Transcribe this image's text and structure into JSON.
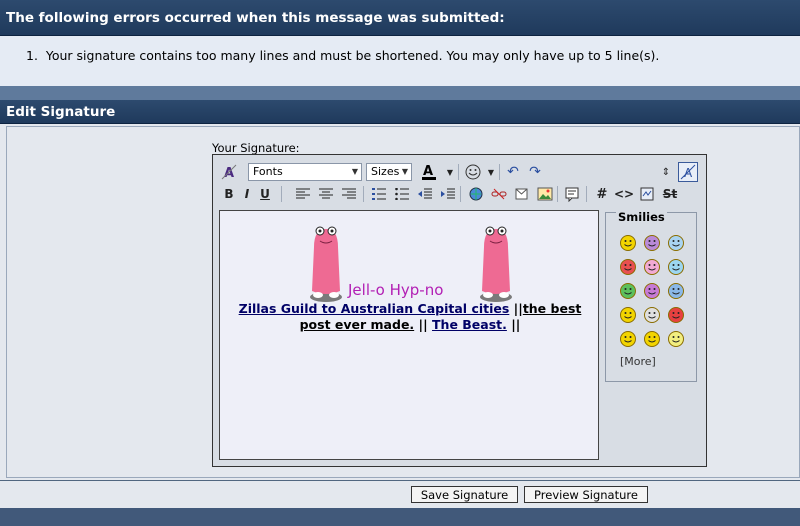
{
  "errors": {
    "title": "The following errors occurred when this message was submitted:",
    "items": [
      "Your signature contains too many lines and must be shortened. You may only have up to 5 line(s)."
    ],
    "numbers": [
      "1."
    ]
  },
  "section": {
    "title": "Edit Signature"
  },
  "editor": {
    "label": "Your Signature:",
    "fonts_value": "Fonts",
    "sizes_value": "Sizes",
    "font_color_glyph": "A",
    "bold": "B",
    "italic": "I",
    "underline": "U",
    "hash": "#",
    "code": "<>",
    "strike": "St"
  },
  "signature": {
    "heading": "Jell-o Hyp-no",
    "link1": "Zillas Guild to Australian Capital cities",
    "sep1": " ||",
    "text1": "the best",
    "text2": "post ever made.",
    "sep2": " || ",
    "link2": "The Beast.",
    "sep3": " ||"
  },
  "smilies": {
    "title": "Smilies",
    "more": "[More]",
    "icons": [
      "smile-icon",
      "mad-icon",
      "confused-icon",
      "frown-icon",
      "tongue-icon",
      "cool-icon",
      "biggrin-icon",
      "eek-icon",
      "rolleyes-icon",
      "sunglasses-icon",
      "crazy-icon",
      "razz-icon",
      "shocked-icon",
      "scared-icon",
      "wink-icon"
    ],
    "colors": [
      "#f2d400",
      "#b98ad8",
      "#a9d4f2",
      "#e85050",
      "#f2aad4",
      "#9cd6f0",
      "#5cc05c",
      "#c77ad6",
      "#8ab8e8",
      "#f2d400",
      "#e0e0e0",
      "#e84040",
      "#f2d400",
      "#f2d400",
      "#f2ee80"
    ]
  },
  "buttons": {
    "save": "Save Signature",
    "preview": "Preview Signature"
  },
  "colors": {
    "header": "#1f3a5c",
    "accent_link": "#000066",
    "heading_purple": "#b21fb4"
  }
}
